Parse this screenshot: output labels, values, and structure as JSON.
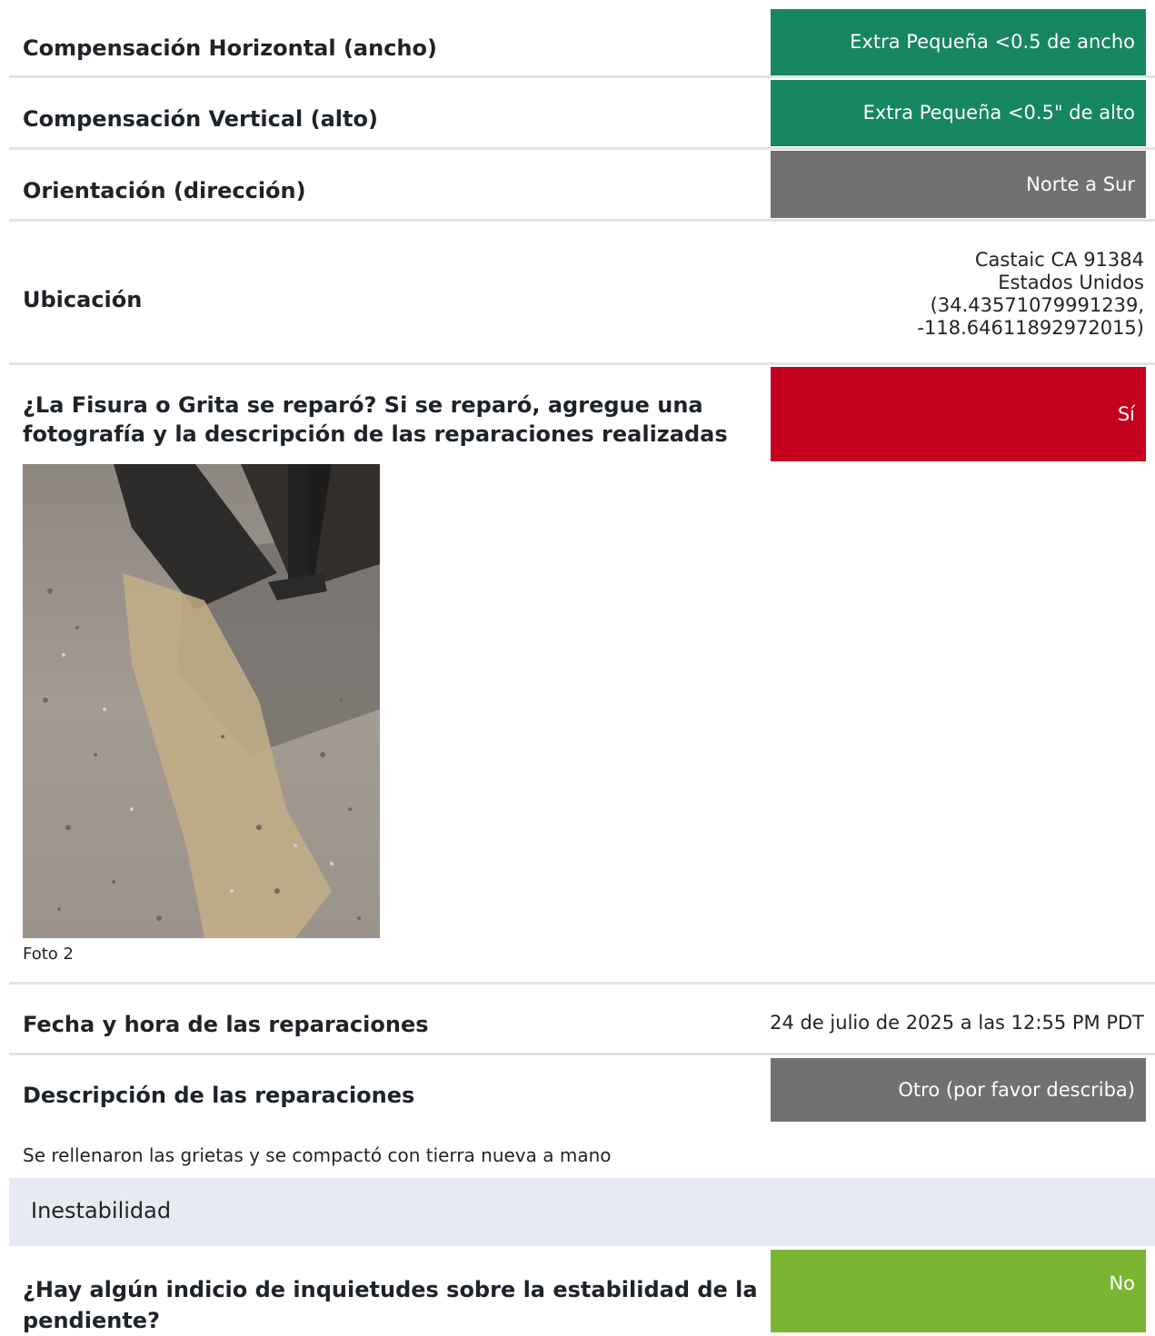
{
  "fields": {
    "horizontal": {
      "label": "Compensación Horizontal (ancho)",
      "value": "Extra Pequeña <0.5 de ancho",
      "color": "#168661"
    },
    "vertical": {
      "label": "Compensación Vertical (alto)",
      "value": "Extra Pequeña <0.5\" de alto",
      "color": "#168661"
    },
    "orientation": {
      "label": "Orientación (dirección)",
      "value": "Norte a Sur",
      "color": "#717171"
    },
    "location": {
      "label": "Ubicación",
      "lines": [
        "Castaic CA 91384",
        "Estados Unidos",
        "(34.43571079991239,",
        "-118.64611892972015)"
      ]
    },
    "repaired": {
      "label_line1": "¿La Fisura o Grita se reparó? Si se reparó, agregue una",
      "label_line2": "fotografía y la descripción de las reparaciones realizadas",
      "value": "Sí",
      "color": "#c4001f"
    },
    "photo": {
      "caption": "Foto 2"
    },
    "repair_date": {
      "label": "Fecha y hora de las reparaciones",
      "value": "24 de julio de 2025 a las 12:55 PM PDT"
    },
    "repair_description": {
      "label": "Descripción de las reparaciones",
      "value": "Otro (por favor describa)",
      "color": "#717171",
      "details": "Se rellenaron las grietas y se compactó con tierra nueva a mano"
    }
  },
  "section": {
    "title": "Inestabilidad"
  },
  "stability": {
    "label_line1": "¿Hay algún indicio de inquietudes sobre la estabilidad de la",
    "label_line2": "pendiente?",
    "value": "No",
    "color": "#7cb532"
  }
}
